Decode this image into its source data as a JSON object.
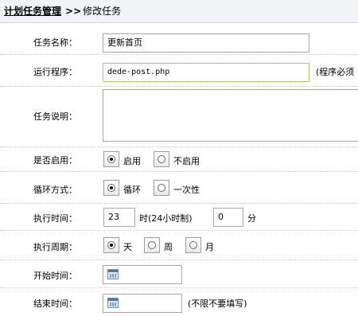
{
  "breadcrumb": {
    "root": "计划任务管理",
    "separator": ">>",
    "current": "修改任务"
  },
  "form": {
    "task_name": {
      "label": "任务名称：",
      "value": "更新首页"
    },
    "program": {
      "label": "运行程序：",
      "value": "dede-post.php",
      "note": "(程序必须"
    },
    "description": {
      "label": "任务说明：",
      "value": ""
    },
    "enabled": {
      "label": "是否启用：",
      "options": [
        "启用",
        "不启用"
      ],
      "selected": "启用"
    },
    "loop_mode": {
      "label": "循环方式：",
      "options": [
        "循环",
        "一次性"
      ],
      "selected": "循环"
    },
    "exec_time": {
      "label": "执行时间：",
      "hour": "23",
      "hour_unit": "时(24小时制)",
      "minute": "0",
      "minute_unit": "分"
    },
    "exec_period": {
      "label": "执行周期：",
      "options": [
        "天",
        "周",
        "月"
      ],
      "selected": "天"
    },
    "start_time": {
      "label": "开始时间：",
      "value": "",
      "icon": "calendar-icon"
    },
    "end_time": {
      "label": "结束时间：",
      "value": "",
      "icon": "calendar-icon",
      "note": "(不限不要填写)"
    }
  }
}
